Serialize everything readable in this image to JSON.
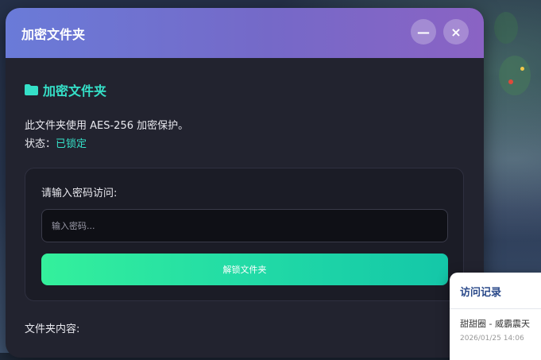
{
  "window": {
    "title": "加密文件夹",
    "minimize_icon": "minus-icon",
    "close_icon": "close-icon"
  },
  "folder": {
    "icon": "folder-icon",
    "name": "加密文件夹",
    "description": "此文件夹使用 AES-256 加密保护。",
    "status_label": "状态：",
    "status_value": "已锁定"
  },
  "unlock": {
    "prompt": "请输入密码访问:",
    "placeholder": "输入密码...",
    "button_label": "解锁文件夹"
  },
  "contents_label": "文件夹内容:",
  "access_log": {
    "title": "访问记录",
    "entry": "甜甜圈 - 威霸震天",
    "time": "2026/01/25 14:06"
  },
  "colors": {
    "accent": "#35e0c8",
    "titlebar_start": "#6a7bd8",
    "titlebar_end": "#8a63c4",
    "button_start": "#34f09c",
    "button_end": "#14c7a8"
  }
}
